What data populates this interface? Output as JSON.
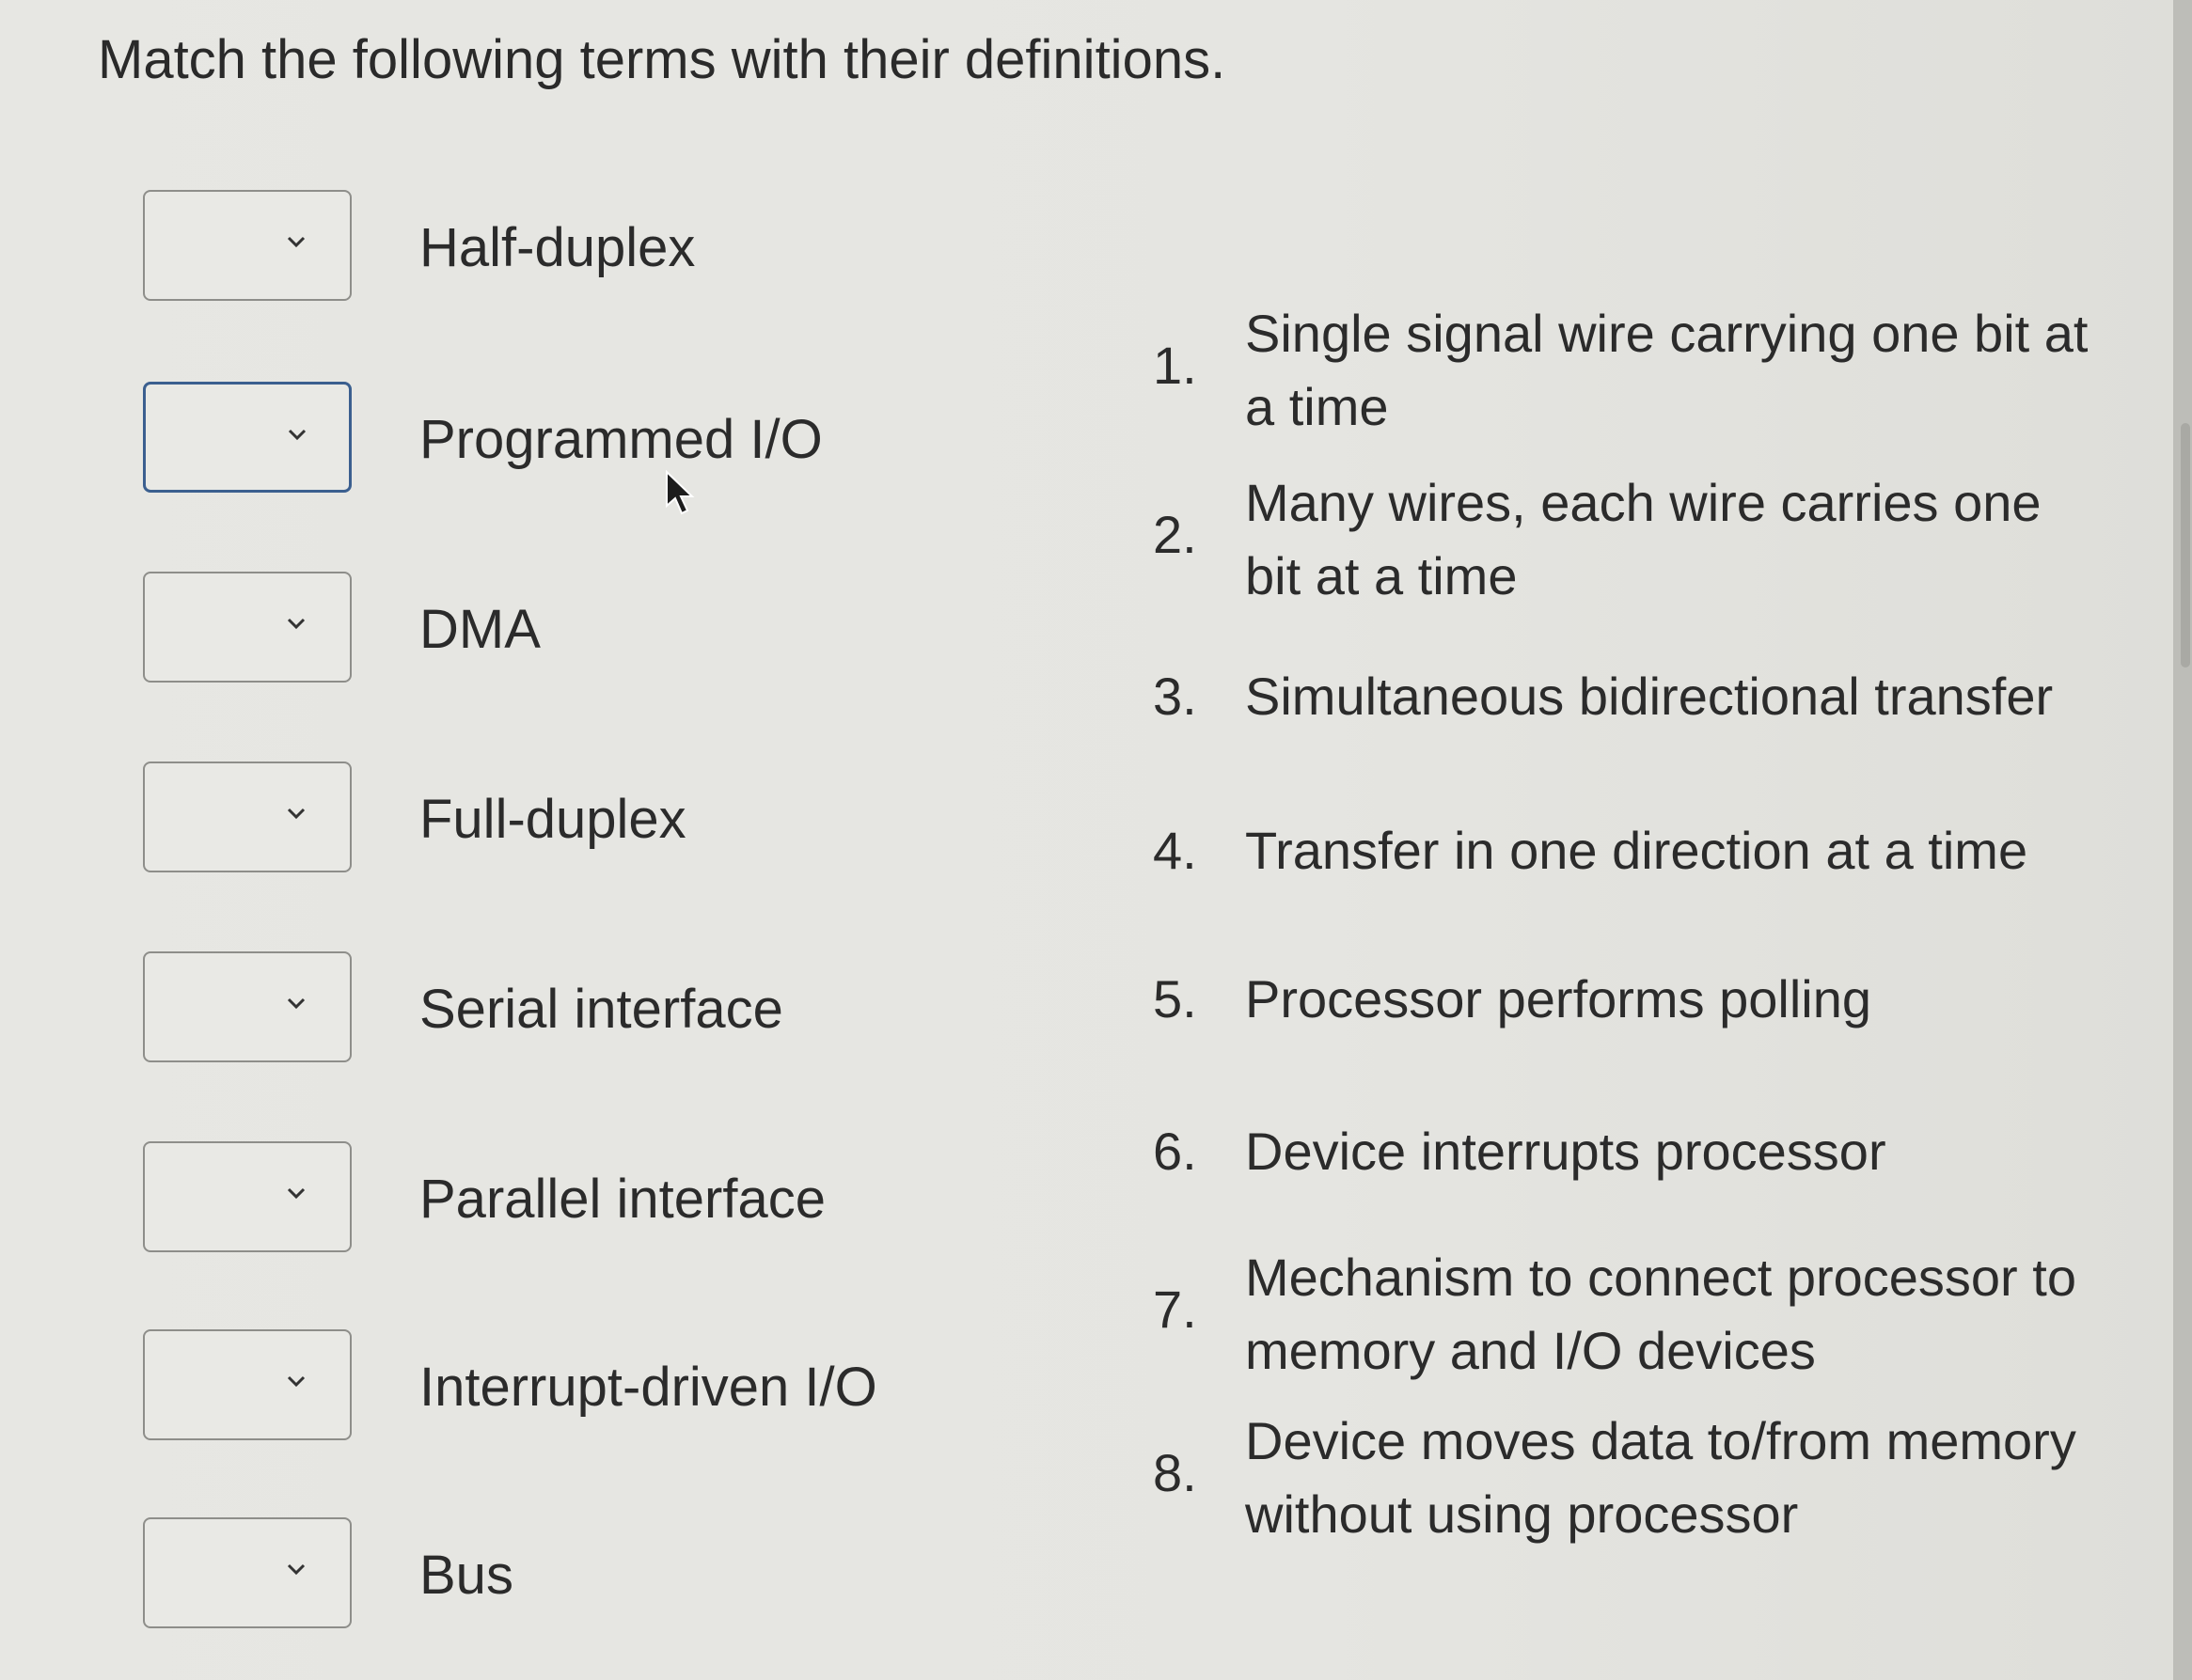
{
  "prompt": "Match the following terms with their definitions.",
  "terms": [
    {
      "label": "Half-duplex",
      "selected": ""
    },
    {
      "label": "Programmed I/O",
      "selected": ""
    },
    {
      "label": "DMA",
      "selected": ""
    },
    {
      "label": "Full-duplex",
      "selected": ""
    },
    {
      "label": "Serial interface",
      "selected": ""
    },
    {
      "label": "Parallel interface",
      "selected": ""
    },
    {
      "label": "Interrupt-driven I/O",
      "selected": ""
    },
    {
      "label": "Bus",
      "selected": ""
    }
  ],
  "definitions": [
    {
      "num": "1.",
      "line1": "Single signal wire carrying one bit at",
      "line2": "a time"
    },
    {
      "num": "2.",
      "line1": "Many wires, each wire carries one",
      "line2": "bit at a time"
    },
    {
      "num": "3.",
      "line1": "Simultaneous bidirectional transfer",
      "line2": ""
    },
    {
      "num": "4.",
      "line1": "Transfer in one direction at a time",
      "line2": ""
    },
    {
      "num": "5.",
      "line1": "Processor performs polling",
      "line2": ""
    },
    {
      "num": "6.",
      "line1": "Device interrupts processor",
      "line2": ""
    },
    {
      "num": "7.",
      "line1": "Mechanism to connect processor to",
      "line2": "memory and I/O devices"
    },
    {
      "num": "8.",
      "line1": "Device moves data to/from memory",
      "line2": "without using processor"
    }
  ],
  "icons": {
    "dropdown": "chevron-down-icon",
    "pointer": "mouse-cursor-icon"
  },
  "colors": {
    "focus_border": "#3b5f8f",
    "text": "#2b2b2b"
  }
}
